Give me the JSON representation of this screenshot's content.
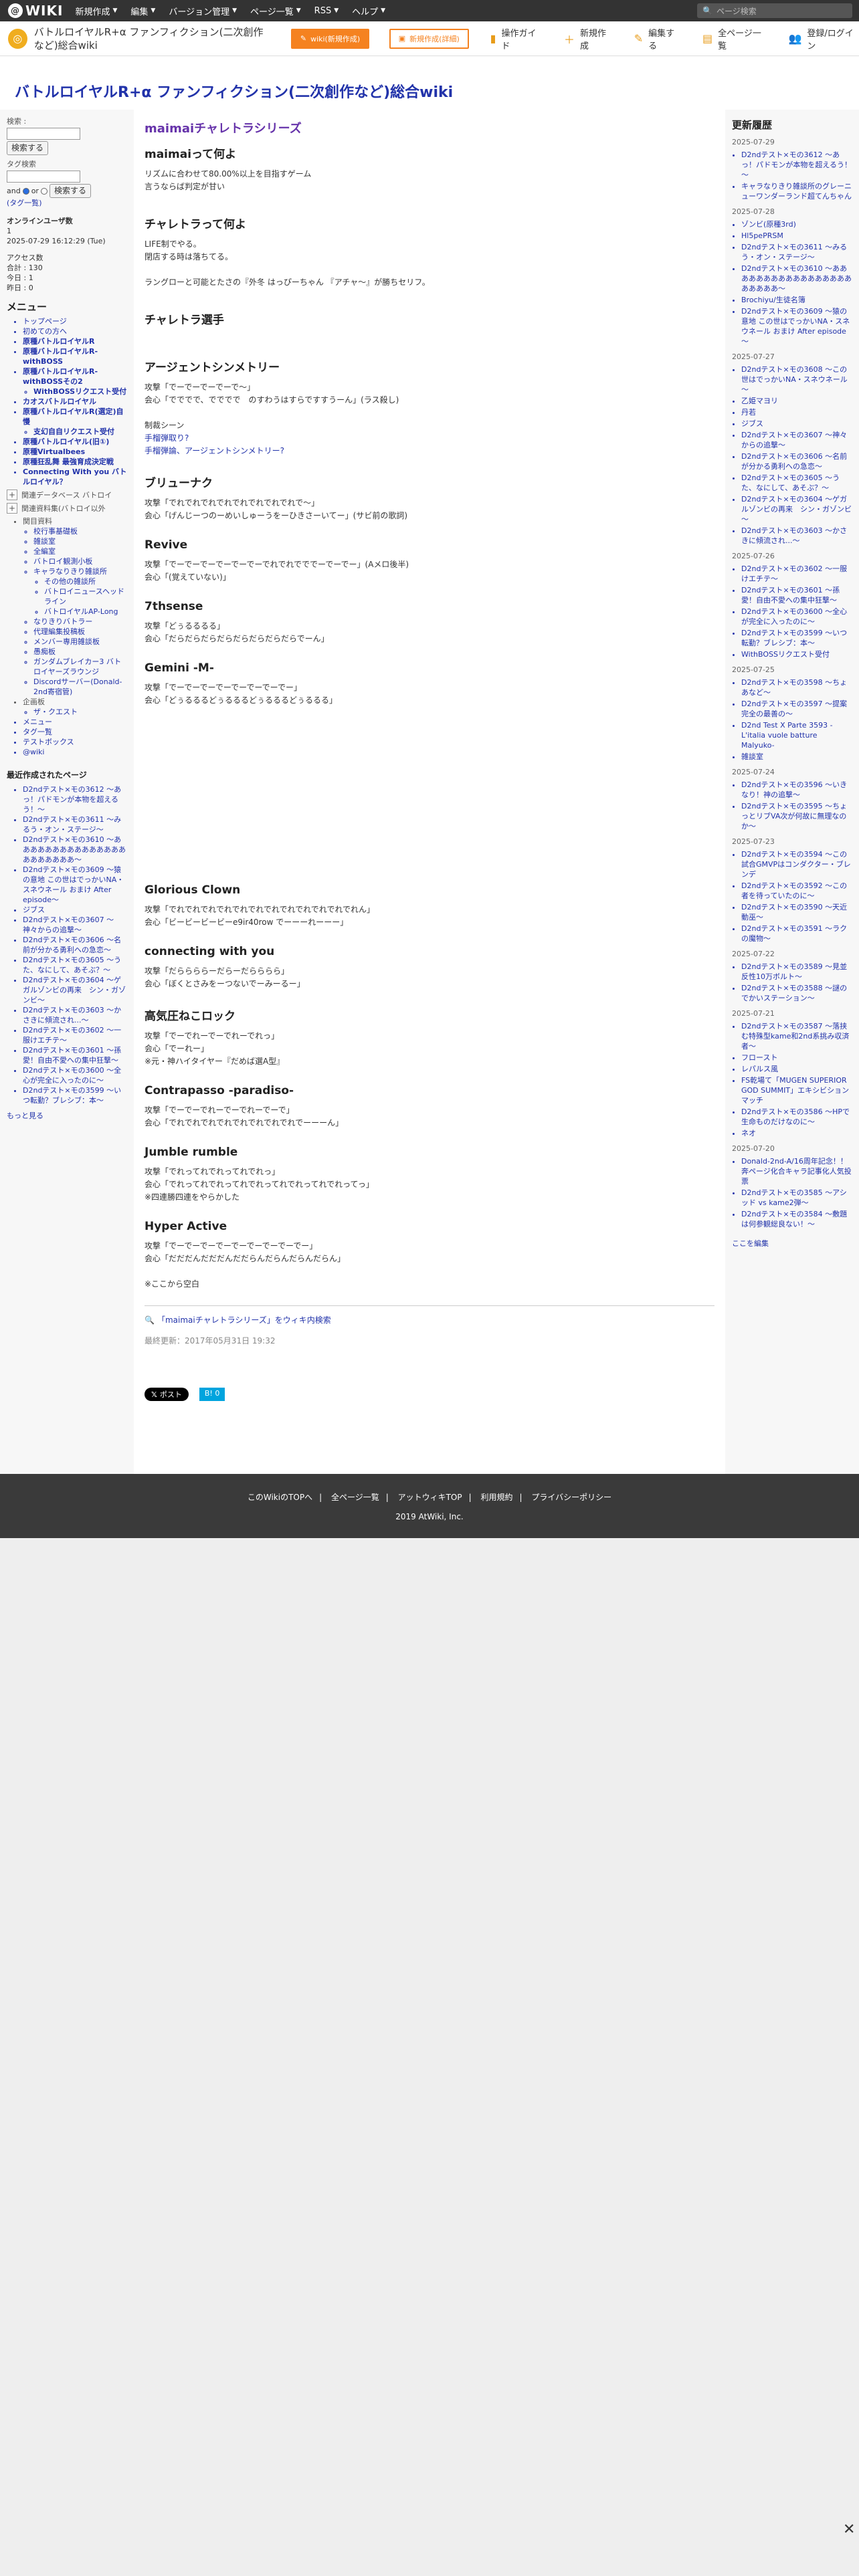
{
  "topbar": {
    "logo": "WIKI",
    "menus": [
      "新規作成",
      "編集",
      "バージョン管理",
      "ページ一覧",
      "RSS",
      "ヘルプ"
    ],
    "search_placeholder": "ページ検索"
  },
  "header": {
    "site_name": "バトルロイヤルR+α ファンフィクション(二次創作など)総合wiki",
    "pro_button": "wiki(新規作成)",
    "repo_button": "新規作成(詳細)",
    "tools": [
      "操作ガイド",
      "新規作成",
      "編集する",
      "全ページ一覧",
      "登録/ログイン"
    ]
  },
  "site_title": "バトルロイヤルR+α ファンフィクション(二次創作など)総合wiki",
  "left": {
    "search_label": "検索 :",
    "search_button": "検索する",
    "tag_label": "タグ検索",
    "and_label": "and",
    "or_label": "or",
    "tag_search_button": "検索する",
    "tag_link": "(タグ一覧)",
    "online_heading": "オンラインユーザ数",
    "online_count": "1",
    "datetime": "2025-07-29 16:12:29 (Tue)",
    "access_heading": "アクセス数",
    "access_total": "合計 : 130",
    "access_today": "今日 : 1",
    "access_yesterday": "昨日 : 0",
    "menu_heading": "メニュー",
    "menu_items": [
      {
        "label": "トップページ",
        "bold": false
      },
      {
        "label": "初めての方へ",
        "bold": false
      },
      {
        "label": "原種バトルロイヤルR",
        "bold": true
      },
      {
        "label": "原種バトルロイヤルR-withBOSS",
        "bold": true
      },
      {
        "label": "原種バトルロイヤルR-withBOSSその2",
        "bold": true
      }
    ],
    "sub_withboss": "WithBOSSリクエスト受付",
    "menu_items2": [
      {
        "label": "カオスバトルロイヤル",
        "bold": true
      },
      {
        "label": "原種バトルロイヤルR(選定)自慢",
        "bold": true
      }
    ],
    "sub_chaos": "支幻自自リクエスト受付",
    "menu_items3": [
      {
        "label": "原種バトルロイヤル(旧①)",
        "bold": true
      },
      {
        "label": "原種Virtualbees",
        "bold": true
      },
      {
        "label": "原種狂乱舞 最強育成決定戦",
        "bold": true
      },
      {
        "label": "Connecting With you バトルロイヤル？",
        "bold": true
      }
    ],
    "toggle1": "関連データベース バトロイ",
    "toggle2": "関連資料集(バトロイ以外",
    "related_heading": "関目資料",
    "related": [
      "校行事基礎板",
      "雑談室",
      "全編室",
      "バトロイ観測小板"
    ],
    "character_heading": "キャラなりきり雑談所",
    "character_sub": [
      "その他の雑談所",
      "バトロイニュースヘッドライン",
      "バトロイヤルAP-Long"
    ],
    "related2": [
      "なりきりバトラー",
      "代理編集投稿板",
      "メンバー専用雑談板",
      "愚痴板",
      "ガンダムブレイカー3 バトロイヤーズラウンジ",
      "Discordサーバー(Donald-2nd寄宿管)"
    ],
    "plan_heading": "企画板",
    "plan_sub": "ザ・クエスト",
    "bottom_links": [
      "メニュー",
      "タグ一覧",
      "テストボックス",
      "@wiki"
    ],
    "recent_heading": "最近作成されたページ",
    "recent": [
      "D2ndテスト×モの3612 ～あっ！パドモンが本物を超えるう！～",
      "D2ndテスト×モの3611 ～みるう・オン・ステージ～",
      "D2ndテスト×モの3610 ～ああああああああああああああああああああああ～",
      "D2ndテスト×モの3609 ～猿の意地 この世はでっかいNA・スネウネール おまけ After episode～",
      "ジブス",
      "D2ndテスト×モの3607 ～神々からの追撃～",
      "D2ndテスト×モの3606 ～名前が分かる勇利への急恋～",
      "D2ndテスト×モの3605 ～うた、なにして、あそぶ？～",
      "D2ndテスト×モの3604 ～ゲガルゾンビの再来　シン・ガゾンビ～",
      "D2ndテスト×モの3603 ～かさきに傾流され...～",
      "D2ndテスト×モの3602 ～一服けエチテ～",
      "D2ndテスト×モの3601 ～孫愛！自由不愛への集中狂撃～",
      "D2ndテスト×モの3600 ～全心が完全に入ったのに～",
      "D2ndテスト×モの3599 ～いつ転勤？ブレシブ：本～"
    ],
    "more_link": "もっと見る"
  },
  "main": {
    "page_title": "maimaiチャレトラシリーズ",
    "sections": [
      {
        "heading": "maimaiって何よ",
        "lines": [
          "リズムに合わせて80.00%以上を目指すゲーム",
          "言うならば判定が甘い"
        ]
      },
      {
        "heading": "チャレトラって何よ",
        "lines": [
          "LIFE制でやる。",
          "閉店する時は落ちてる。",
          "",
          "ラングローと可能とたさの『外冬 はっぴーちゃん 『アチャ～』が勝ちセリフ。"
        ]
      },
      {
        "heading": "チャレトラ選手",
        "lines": []
      },
      {
        "heading": "アージェントシンメトリー",
        "lines": [
          "攻撃「でーでーでーでーで～」",
          "会心「でででで、でででで　のすわうはすらですすうーん」(ラス殺し)",
          "",
          "制裁シーン"
        ]
      },
      {
        "heading": "ブリューナク",
        "lines": [
          "攻撃「でれでれでれでれでれでれでれでれで～」",
          "会心「げんじーつのーめいしゅーうをーひきさーいてー」(サビ前の歌詞)"
        ]
      },
      {
        "heading": "Revive",
        "lines": [
          "攻撃「でーでーでーでーでーでーでれでれでででーでーでー」(Aメロ後半)",
          "会心「(覚えていない)」"
        ]
      },
      {
        "heading": "7thsense",
        "lines": [
          "攻撃「どぅるるるる」",
          "会心「だらだらだらだらだらだらだらだらでーん」"
        ]
      },
      {
        "heading": "Gemini -M-",
        "lines": [
          "攻撃「でーでーでーでーでーでーでーでー」",
          "会心「どぅるるるどぅるるるどぅるるるどぅるるる」"
        ]
      },
      {
        "heading": "Glorious Clown",
        "lines": [
          "攻撃「でれでれでれでれでれでれでれでれでれでれでれでれん」",
          "会心「ビービービービーe9ir40row でーーーれーーー」"
        ]
      },
      {
        "heading": "connecting with you",
        "lines": [
          "攻撃「だららららーだらーだらららら」",
          "会心「ぼくとさみをーつないでーみーるー」"
        ]
      },
      {
        "heading": "高気圧ねこロック",
        "lines": [
          "攻撃「でーでれーでーでれーでれっ」",
          "会心「でーれー」",
          "※元・神ハイタイヤー『だめば選A型』"
        ]
      },
      {
        "heading": "Contrapasso -paradiso-",
        "lines": [
          "攻撃「でーでーでれーでーでれーでーで」",
          "会心「でれでれでれでれでれでれでれでれでーーーん」"
        ]
      },
      {
        "heading": "Jumble rumble",
        "lines": [
          "攻撃「でれってれでれってれでれっ」",
          "会心「でれってれでれってれでれってれでれってれでれってっ」",
          "※四連勝四連をやらかした"
        ]
      },
      {
        "heading": "Hyper Active",
        "lines": [
          "攻撃「でーでーでーでーでーでーでーでーでー」",
          "会心「だだだんだだだんだだらんだらんだらんだらん」",
          "",
          "※ここから空白"
        ]
      }
    ],
    "links_in_section": [
      "手榴弾取り?",
      "手榴弾論、アージェントシンメトリー?"
    ],
    "search_link": "「maimaiチャレトラシリーズ」をウィキ内検索",
    "updated": "最終更新：2017年05月31日 19:32",
    "xpost": "ポスト",
    "hatena": "B! 0"
  },
  "right": {
    "heading": "更新履歴",
    "groups": [
      {
        "date": "2025-07-29",
        "items": [
          "D2ndテスト×モの3612 ～あっ！パドモンが本物を超えるう！～",
          "キャラなりきり雑談所のグレーニューワンダーランド超てんちゃん"
        ]
      },
      {
        "date": "2025-07-28",
        "items": [
          "ゾンビ(原種3rd)",
          "Hl5pePRSM",
          "D2ndテスト×モの3611 ～みるう・オン・ステージ～",
          "D2ndテスト×モの3610 ～ああああああああああああああああああああああ～",
          "Brochiyu/生徒名簿",
          "D2ndテスト×モの3609 ～猿の意地 この世はでっかいNA・スネウネール おまけ After episode～"
        ]
      },
      {
        "date": "2025-07-27",
        "items": [
          "D2ndテスト×モの3608 ～この世はでっかいNA・スネウネール～",
          "乙姫マヨリ",
          "丹若",
          "ジブス",
          "D2ndテスト×モの3607 ～神々からの追撃～",
          "D2ndテスト×モの3606 ～名前が分かる勇利への急恋～",
          "D2ndテスト×モの3605 ～うた、なにして、あそぶ？～",
          "D2ndテスト×モの3604 ～ゲガルゾンビの再来　シン・ガゾンビ～",
          "D2ndテスト×モの3603 ～かさきに傾流され...～"
        ]
      },
      {
        "date": "2025-07-26",
        "items": [
          "D2ndテスト×モの3602 ～一服けエチテ～",
          "D2ndテスト×モの3601 ～孫愛！自由不愛への集中狂撃～",
          "D2ndテスト×モの3600 ～全心が完全に入ったのに～",
          "D2ndテスト×モの3599 ～いつ転勤？ブレシブ：本～",
          "WithBOSSリクエスト受付"
        ]
      },
      {
        "date": "2025-07-25",
        "items": [
          "D2ndテスト×モの3598 ～ちょあなど～",
          "D2ndテスト×モの3597 ～提案完全の最善の～",
          "D2nd Test X Parte 3593 - L'italia vuole batture Malyuko-",
          "雑談室"
        ]
      },
      {
        "date": "2025-07-24",
        "items": [
          "D2ndテスト×モの3596 ～いきなり！神の追撃～",
          "D2ndテスト×モの3595 ～ちょっとリブVA次が何故に無理なのか～"
        ]
      },
      {
        "date": "2025-07-23",
        "items": [
          "D2ndテスト×モの3594 ～この試合GMVPはコンダクター・ブレンデ",
          "D2ndテスト×モの3592 ～この者を待っていたのに～",
          "D2ndテスト×モの3590 ～天近動巫～",
          "D2ndテスト×モの3591 ～ラクの魔物～"
        ]
      },
      {
        "date": "2025-07-22",
        "items": [
          "D2ndテスト×モの3589 ～見並反性10万ボルト～",
          "D2ndテスト×モの3588 ～謎のでかいステーション～"
        ]
      },
      {
        "date": "2025-07-21",
        "items": [
          "D2ndテスト×モの3587 ～落挟む特殊型kame和2nd系挑み収済者～",
          "フロースト",
          "レパルス風",
          "FS乾場て「MUGEN SUPERIOR GOD SUMMIT」エキシビションマッチ",
          "D2ndテスト×モの3586 ～HPで生命ものだけなのに～",
          "ネオ"
        ]
      },
      {
        "date": "2025-07-20",
        "items": [
          "Donald-2nd-A/16周年記念！！奔ページ化合キャラ記事化人気投票",
          "D2ndテスト×モの3585 ～アシッド vs kame2弾～",
          "D2ndテスト×モの3584 ～敷題は何参観総良ない！～"
        ]
      }
    ],
    "edit_link": "ここを編集"
  },
  "footer": {
    "links": [
      "このWikiのTOPへ",
      "全ページ一覧",
      "アットウィキTOP",
      "利用規約",
      "プライバシーポリシー"
    ],
    "copyright": "2019 AtWiki, Inc."
  },
  "close_icon": "✕"
}
